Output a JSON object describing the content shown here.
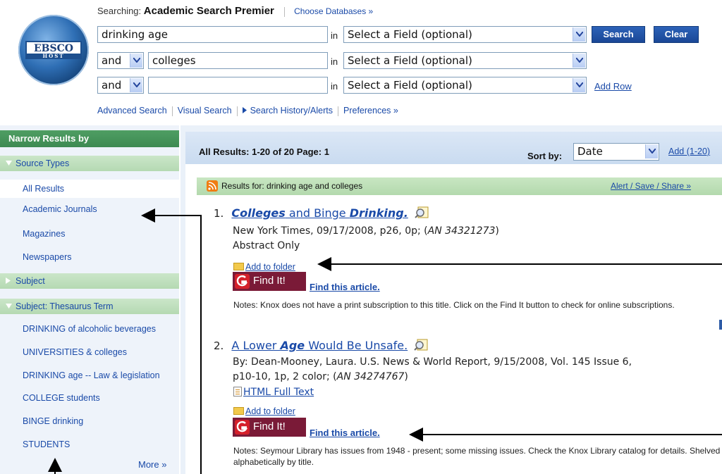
{
  "header": {
    "logo_text": "EBSCO",
    "logo_sub": "HOST",
    "searching_label": "Searching:",
    "database": "Academic Search Premier",
    "choose_databases": "Choose Databases »",
    "rows": [
      {
        "value": "drinking age",
        "field": "Select a Field (optional)"
      },
      {
        "operator": "and",
        "value": "colleges",
        "field": "Select a Field (optional)"
      },
      {
        "operator": "and",
        "value": "",
        "field": "Select a Field (optional)"
      }
    ],
    "in_label": "in",
    "search_button": "Search",
    "clear_button": "Clear",
    "add_row": "Add Row",
    "links": {
      "advanced": "Advanced Search",
      "visual": "Visual Search",
      "history": "Search History/Alerts",
      "preferences": "Preferences »"
    }
  },
  "sidebar": {
    "title": "Narrow Results by",
    "source_types": "Source Types",
    "all_results": "All Results",
    "source_items": [
      "Academic Journals",
      "Magazines",
      "Newspapers"
    ],
    "subject": "Subject",
    "thesaurus": "Subject: Thesaurus Term",
    "thesaurus_items": [
      "DRINKING of alcoholic beverages",
      "UNIVERSITIES & colleges",
      "DRINKING age -- Law & legislation",
      "COLLEGE students",
      "BINGE drinking",
      "STUDENTS"
    ],
    "more": "More »"
  },
  "results": {
    "summary": "All Results: 1-20 of 20   Page: 1",
    "sort_label": "Sort by:",
    "sort_value": "Date",
    "add_link": "Add (1-20)",
    "results_for": "Results for: drinking age and colleges",
    "alert_link": "Alert / Save / Share »",
    "items": [
      {
        "num": "1.",
        "title_a": "Colleges",
        "title_b": " and Binge ",
        "title_c": "Drinking.",
        "source": "New York Times, 09/17/2008, p26, 0p; (",
        "an": "AN 34321273",
        "source_end": ")",
        "abstract": "Abstract Only",
        "folder": "Add to folder",
        "findit": "Find It!",
        "find_article": "Find this article.",
        "notes": "Notes:   Knox does not have a print subscription to this title. Click on the Find It button to check for online subscriptions."
      },
      {
        "num": "2.",
        "title_a": "A Lower ",
        "title_b": "Age",
        "title_c": " Would Be Unsafe.",
        "source1": "By: Dean-Mooney, Laura. U.S. News & World Report, 9/15/2008, Vol. 145 Issue 6,",
        "source2": "p10-10, 1p, 2 color; (",
        "an": "AN 34274767",
        "source_end": ")",
        "fulltext": "HTML Full Text",
        "folder": "Add to folder",
        "findit": "Find It!",
        "find_article": "Find this article.",
        "notes": "Notes:   Seymour Library has issues from 1948 - present; some missing issues. Check the Knox Library catalog for details. Shelved alphabetically by title."
      }
    ]
  },
  "colors": {
    "accent": "#1a4aa8",
    "sidebar_green": "#3d8a52",
    "findit": "#7a1a37",
    "button": "#1a4796"
  }
}
